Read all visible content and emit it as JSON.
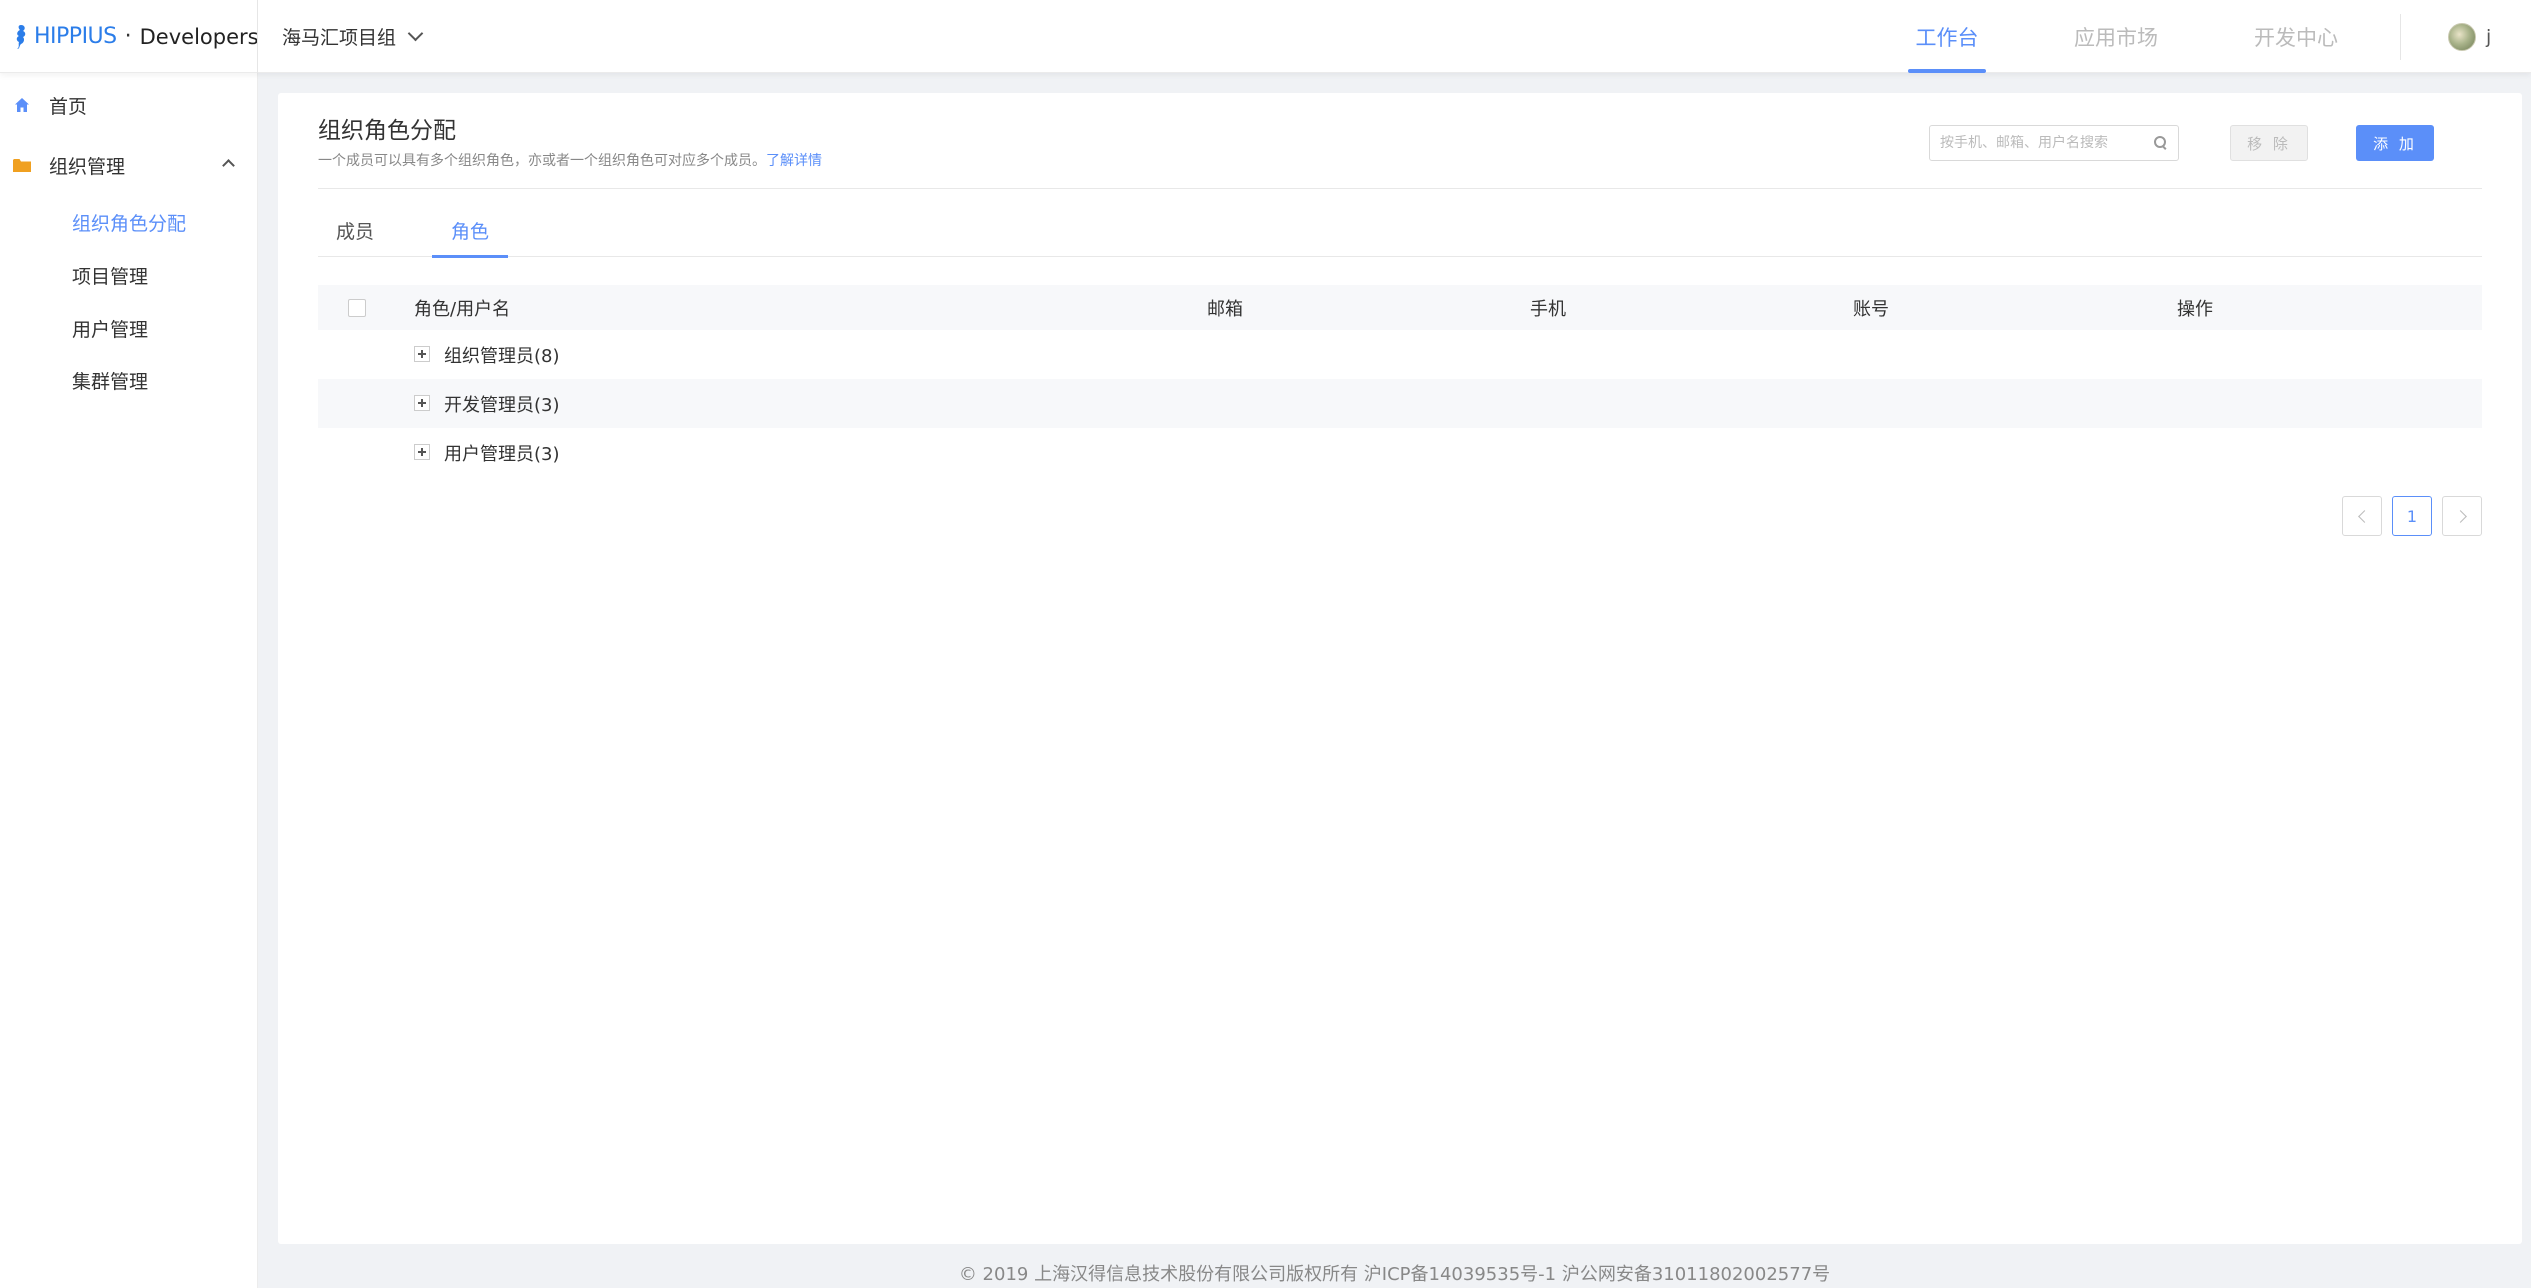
{
  "header": {
    "brand_name": "HIPPIUS",
    "brand_separator": "·",
    "brand_suffix": "Developers",
    "group_selector": "海马汇项目组",
    "nav": [
      {
        "label": "工作台",
        "active": true
      },
      {
        "label": "应用市场",
        "active": false
      },
      {
        "label": "开发中心",
        "active": false
      }
    ],
    "user_name": "j"
  },
  "sidebar": {
    "home": "首页",
    "org_management": "组织管理",
    "sub_items": [
      {
        "label": "组织角色分配",
        "active": true
      },
      {
        "label": "项目管理",
        "active": false
      },
      {
        "label": "用户管理",
        "active": false
      },
      {
        "label": "集群管理",
        "active": false
      }
    ]
  },
  "main": {
    "title": "组织角色分配",
    "description": "一个成员可以具有多个组织角色，亦或者一个组织角色可对应多个成员。",
    "description_link": "了解详情",
    "search_placeholder": "按手机、邮箱、用户名搜索",
    "remove_button": "移 除",
    "add_button": "添 加",
    "tabs": [
      {
        "label": "成员",
        "active": false
      },
      {
        "label": "角色",
        "active": true
      }
    ],
    "table": {
      "columns": [
        "角色/用户名",
        "邮箱",
        "手机",
        "账号",
        "操作"
      ],
      "rows": [
        {
          "name": "组织管理员(8)"
        },
        {
          "name": "开发管理员(3)"
        },
        {
          "name": "用户管理员(3)"
        }
      ]
    },
    "pagination": {
      "current_page": "1"
    }
  },
  "footer": {
    "text": "© 2019 上海汉得信息技术股份有限公司版权所有  沪ICP备14039535号-1  沪公网安备31011802002577号"
  },
  "colors": {
    "accent": "#5b8ff9",
    "brand": "#2b7de9",
    "sidebar_folder": "#f0a020"
  }
}
